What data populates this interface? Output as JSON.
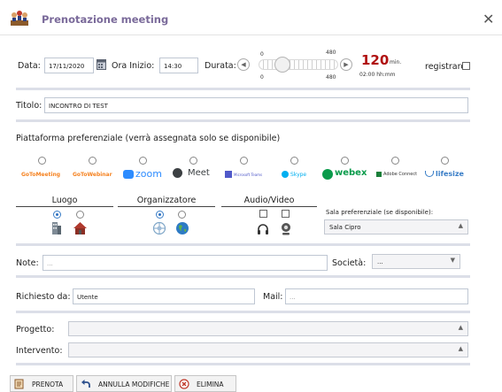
{
  "window": {
    "title": "Prenotazione meeting"
  },
  "date_row": {
    "date_label": "Data:",
    "date_value": "17/11/2020",
    "start_label": "Ora Inizio:",
    "start_value": "14:30",
    "duration_label": "Durata:",
    "slider_min": "0",
    "slider_max": "480",
    "slider_value": 120,
    "duration_value": "120",
    "duration_unit": "min.",
    "duration_hhmm": "02:00 hh:mm",
    "record_label": "registrare:"
  },
  "title_row": {
    "label": "Titolo:",
    "value": "INCONTRO DI TEST"
  },
  "platforms": {
    "heading": "Piattaforma preferenziale (verrà assegnata solo se disponibile)",
    "items": [
      {
        "label": "GoToMeeting",
        "color": "#f58220"
      },
      {
        "label": "GoToWebinar",
        "color": "#f58220"
      },
      {
        "label": "zoom",
        "color": "#2d8cff"
      },
      {
        "label": "Meet",
        "color": "#3c4043"
      },
      {
        "label": "Microsoft Teams",
        "color": "#5059c9"
      },
      {
        "label": "Skype",
        "color": "#00aff0"
      },
      {
        "label": "webex",
        "color": "#0a9b4b"
      },
      {
        "label": "Adobe Connect",
        "color": "#333333"
      },
      {
        "label": "lifesize",
        "color": "#3a7ec7"
      }
    ]
  },
  "options": {
    "luogo_label": "Luogo",
    "organizzatore_label": "Organizzatore",
    "audio_video_label": "Audio/Video",
    "room_label": "Sala preferenziale (se disponibile):",
    "room_value": "Sala Cipro"
  },
  "note_row": {
    "label": "Note:",
    "placeholder": "...",
    "company_label": "Società:",
    "company_value": "..."
  },
  "request_row": {
    "label": "Richiesto da:",
    "value": "Utente",
    "mail_label": "Mail:",
    "mail_placeholder": "..."
  },
  "project_row": {
    "label": "Progetto:",
    "value": ""
  },
  "intervention_row": {
    "label": "Intervento:",
    "value": ""
  },
  "buttons": {
    "book": "PRENOTA",
    "cancel_changes": "ANNULLA MODIFICHE",
    "delete": "ELIMINA"
  }
}
